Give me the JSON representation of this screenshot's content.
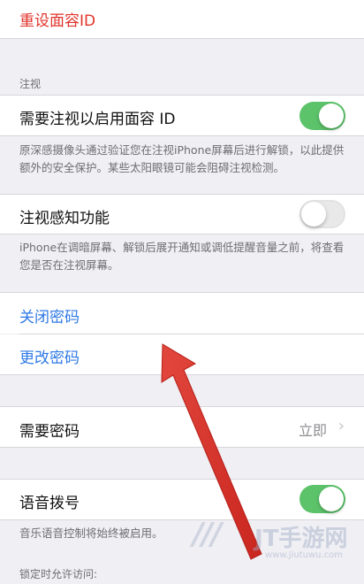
{
  "top_action": {
    "label": "重设面容ID"
  },
  "attention_section": {
    "header": "注视",
    "require_attention": {
      "label": "需要注视以启用面容 ID",
      "enabled": true
    },
    "require_attention_footer": "原深感摄像头通过验证您在注视iPhone屏幕后进行解锁，以此提供额外的安全保护。某些太阳眼镜可能会阻碍注视检测。",
    "attention_aware": {
      "label": "注视感知功能",
      "enabled": false
    },
    "attention_aware_footer": "iPhone在调暗屏幕、解锁后展开通知或调低提醒音量之前，将查看您是否在注视屏幕。"
  },
  "passcode_section": {
    "turn_off": "关闭密码",
    "change": "更改密码"
  },
  "require_passcode": {
    "label": "需要密码",
    "value": "立即",
    "chevron": "chevron-right-icon"
  },
  "voice_dial": {
    "label": "语音拨号",
    "enabled": true,
    "footer": "音乐语音控制将始终被启用。"
  },
  "locked_access_header": "锁定时允许访问:",
  "watermark": {
    "brand": "JT手游网",
    "domain": "www.jiutuwu.com",
    "icon": "watermark-logo"
  },
  "colors": {
    "background": "#efeff4",
    "switch_on": "#5cc36a",
    "destructive": "#e0332b",
    "link": "#2f7ae5",
    "annotation_arrow": "#d9342b"
  }
}
